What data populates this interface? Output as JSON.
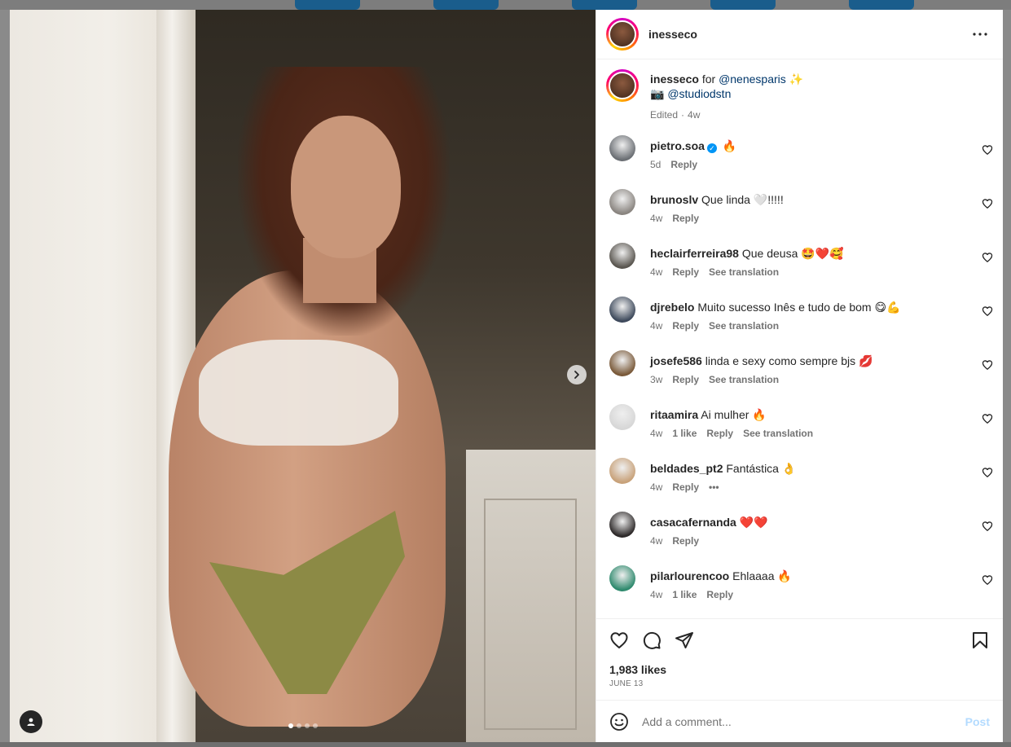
{
  "post": {
    "username": "inesseco",
    "caption": {
      "username": "inesseco",
      "text_for": "for",
      "mention_1": "@nenesparis",
      "emoji_1": "✨",
      "camera_emoji": "📷",
      "mention_2": "@studiodstn",
      "edited": "Edited",
      "time": "4w"
    },
    "comments": [
      {
        "username": "pietro.soa",
        "verified": true,
        "text": "🔥",
        "time": "5d",
        "likes": "",
        "reply": "Reply",
        "translation": "",
        "avatar_color": "#6b6f74"
      },
      {
        "username": "brunoslv",
        "verified": false,
        "text": "Que linda 🤍!!!!!",
        "time": "4w",
        "likes": "",
        "reply": "Reply",
        "translation": "",
        "avatar_color": "#8a8580"
      },
      {
        "username": "heclairferreira98",
        "verified": false,
        "text": "Que deusa 🤩❤️🥰",
        "time": "4w",
        "likes": "",
        "reply": "Reply",
        "translation": "See translation",
        "avatar_color": "#5a5650"
      },
      {
        "username": "djrebelo",
        "verified": false,
        "text": "Muito sucesso Inês e tudo de bom 😋💪",
        "time": "4w",
        "likes": "",
        "reply": "Reply",
        "translation": "See translation",
        "avatar_color": "#3e4a5c"
      },
      {
        "username": "josefe586",
        "verified": false,
        "text": "linda e sexy como sempre bjs 💋",
        "time": "3w",
        "likes": "",
        "reply": "Reply",
        "translation": "See translation",
        "avatar_color": "#7a5a3a"
      },
      {
        "username": "ritaamira",
        "verified": false,
        "text": "Ai mulher 🔥",
        "time": "4w",
        "likes": "1 like",
        "reply": "Reply",
        "translation": "See translation",
        "avatar_color": "#d7d7d7"
      },
      {
        "username": "beldades_pt2",
        "verified": false,
        "text": "Fantástica 👌",
        "time": "4w",
        "likes": "",
        "reply": "Reply",
        "translation": "",
        "more": "•••",
        "avatar_color": "#c8a27a"
      },
      {
        "username": "casacafernanda",
        "verified": false,
        "text": "❤️❤️",
        "time": "4w",
        "likes": "",
        "reply": "Reply",
        "translation": "",
        "avatar_color": "#2e2a2a"
      },
      {
        "username": "pilarlourencoo",
        "verified": false,
        "text": "Ehlaaaa 🔥",
        "time": "4w",
        "likes": "1 like",
        "reply": "Reply",
        "translation": "",
        "avatar_color": "#2f8a6e"
      }
    ],
    "likes": "1,983 likes",
    "date": "JUNE 13"
  },
  "add_comment": {
    "placeholder": "Add a comment...",
    "post_label": "Post"
  },
  "icons": {
    "more": "more-options-icon",
    "like": "heart-icon",
    "comment": "comment-icon",
    "share": "share-icon",
    "save": "bookmark-icon",
    "emoji": "emoji-icon",
    "next": "chevron-right-icon",
    "tag": "user-tag-icon"
  },
  "colors": {
    "link": "#00376b",
    "muted": "#737373",
    "verified": "#0095f6",
    "post_disabled": "#b3dbff"
  },
  "carousel": {
    "count": 4,
    "active": 0
  }
}
